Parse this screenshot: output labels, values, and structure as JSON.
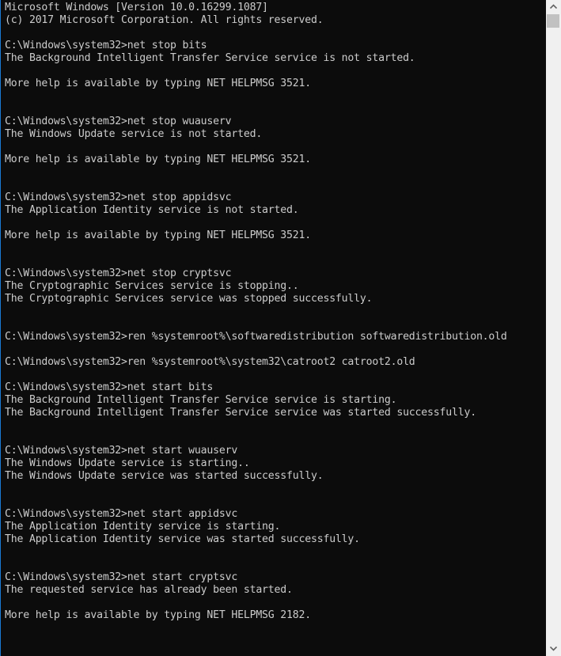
{
  "window": {
    "type": "Command Prompt console"
  },
  "console": {
    "lines": [
      "Microsoft Windows [Version 10.0.16299.1087]",
      "(c) 2017 Microsoft Corporation. All rights reserved.",
      "",
      "C:\\Windows\\system32>net stop bits",
      "The Background Intelligent Transfer Service service is not started.",
      "",
      "More help is available by typing NET HELPMSG 3521.",
      "",
      "",
      "C:\\Windows\\system32>net stop wuauserv",
      "The Windows Update service is not started.",
      "",
      "More help is available by typing NET HELPMSG 3521.",
      "",
      "",
      "C:\\Windows\\system32>net stop appidsvc",
      "The Application Identity service is not started.",
      "",
      "More help is available by typing NET HELPMSG 3521.",
      "",
      "",
      "C:\\Windows\\system32>net stop cryptsvc",
      "The Cryptographic Services service is stopping..",
      "The Cryptographic Services service was stopped successfully.",
      "",
      "",
      "C:\\Windows\\system32>ren %systemroot%\\softwaredistribution softwaredistribution.old",
      "",
      "C:\\Windows\\system32>ren %systemroot%\\system32\\catroot2 catroot2.old",
      "",
      "C:\\Windows\\system32>net start bits",
      "The Background Intelligent Transfer Service service is starting.",
      "The Background Intelligent Transfer Service service was started successfully.",
      "",
      "",
      "C:\\Windows\\system32>net start wuauserv",
      "The Windows Update service is starting..",
      "The Windows Update service was started successfully.",
      "",
      "",
      "C:\\Windows\\system32>net start appidsvc",
      "The Application Identity service is starting.",
      "The Application Identity service was started successfully.",
      "",
      "",
      "C:\\Windows\\system32>net start cryptsvc",
      "The requested service has already been started.",
      "",
      "More help is available by typing NET HELPMSG 2182."
    ]
  },
  "scrollbar": {
    "up_icon": "chevron-up",
    "down_icon": "chevron-down",
    "up_glyph": "︿",
    "down_glyph": "﹀"
  },
  "colors": {
    "background": "#0c0c0c",
    "text": "#cccccc",
    "scrollbar_track": "#f0f0f0",
    "scrollbar_thumb": "#c1c1c1",
    "window_border": "#1a7ad4"
  }
}
